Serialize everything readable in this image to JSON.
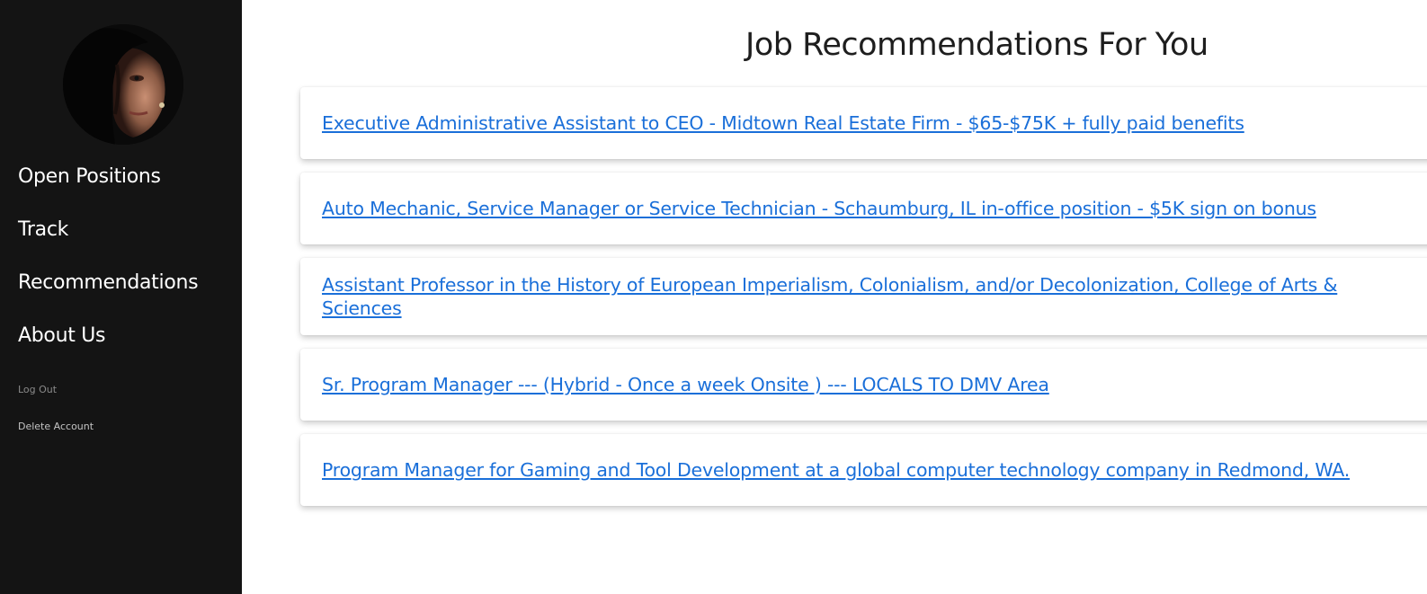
{
  "sidebar": {
    "nav": [
      {
        "label": "Open Positions"
      },
      {
        "label": "Track"
      },
      {
        "label": "Recommendations"
      },
      {
        "label": "About Us"
      }
    ],
    "logout_label": "Log Out",
    "delete_label": "Delete Account"
  },
  "main": {
    "title": "Job Recommendations For You",
    "jobs": [
      {
        "title": "Executive Administrative Assistant to CEO - Midtown Real Estate Firm - $65-$75K + fully paid benefits"
      },
      {
        "title": "Auto Mechanic, Service Manager or Service Technician - Schaumburg, IL in-office position - $5K sign on bonus"
      },
      {
        "title": "Assistant Professor in the History of European Imperialism, Colonialism, and/or Decolonization, College of Arts & Sciences"
      },
      {
        "title": "Sr. Program Manager --- (Hybrid - Once a week Onsite ) --- LOCALS TO DMV Area"
      },
      {
        "title": "Program Manager for Gaming and Tool Development at a global computer technology company in Redmond, WA."
      }
    ]
  },
  "colors": {
    "sidebar_bg": "#141414",
    "link": "#1a6fd9",
    "title": "#1e1e1e"
  }
}
